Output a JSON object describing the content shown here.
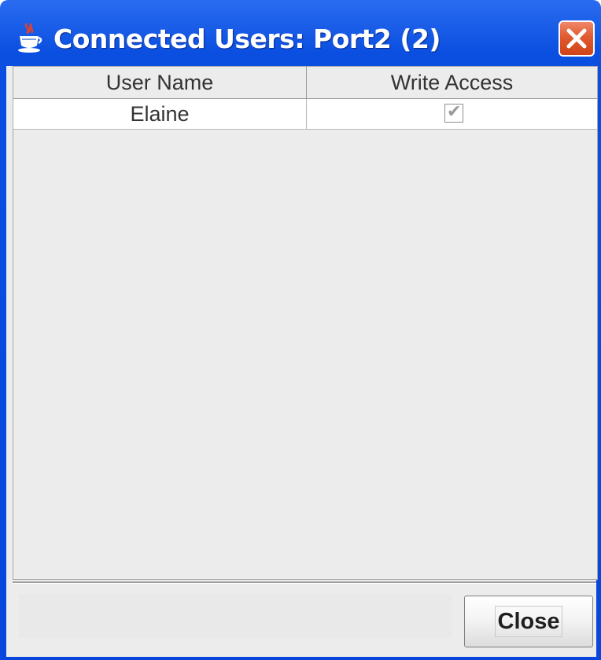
{
  "window": {
    "title": "Connected Users: Port2 (2)",
    "app_icon": "java-cup-icon",
    "close_icon": "close-icon",
    "colors": {
      "titlebar": "#0846dc",
      "close_button": "#e05a30",
      "client_bg": "#ececec"
    }
  },
  "table": {
    "columns": [
      "User Name",
      "Write Access"
    ],
    "rows": [
      {
        "user_name": "Elaine",
        "write_access": true
      }
    ]
  },
  "footer": {
    "close_label": "Close"
  }
}
